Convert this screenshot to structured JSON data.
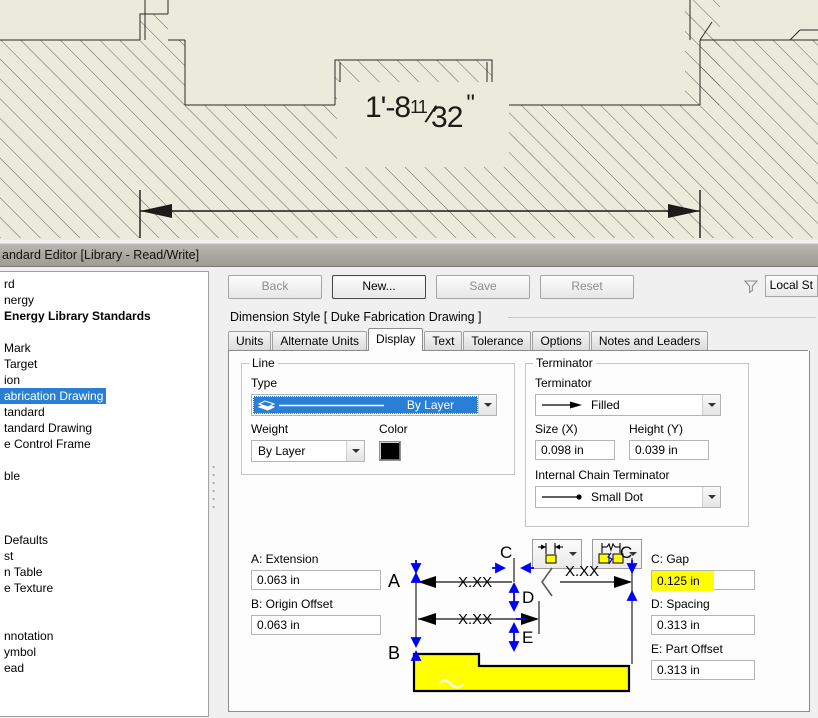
{
  "cad": {
    "dimension_text": {
      "whole": "1'-8",
      "numerator": "11",
      "denominator": "32",
      "unit_mark": "\""
    },
    "background_color": "#eceadb",
    "line_color": "#2b2b24"
  },
  "window": {
    "title": "andard Editor [Library - Read/Write]"
  },
  "tree": {
    "items": [
      {
        "label": "rd",
        "bold": false,
        "selected": false
      },
      {
        "label": "nergy",
        "bold": false,
        "selected": false
      },
      {
        "label": "Energy Library Standards",
        "bold": true,
        "selected": false
      },
      {
        "label": "",
        "bold": false,
        "selected": false
      },
      {
        "label": "Mark",
        "bold": false,
        "selected": false
      },
      {
        "label": "Target",
        "bold": false,
        "selected": false
      },
      {
        "label": "ion",
        "bold": false,
        "selected": false
      },
      {
        "label": "abrication Drawing",
        "bold": false,
        "selected": true
      },
      {
        "label": "tandard",
        "bold": false,
        "selected": false
      },
      {
        "label": "tandard Drawing",
        "bold": false,
        "selected": false
      },
      {
        "label": "e Control Frame",
        "bold": false,
        "selected": false
      },
      {
        "label": "",
        "bold": false,
        "selected": false
      },
      {
        "label": "ble",
        "bold": false,
        "selected": false
      },
      {
        "label": "",
        "bold": false,
        "selected": false
      },
      {
        "label": "",
        "bold": false,
        "selected": false
      },
      {
        "label": "",
        "bold": false,
        "selected": false
      },
      {
        "label": "Defaults",
        "bold": false,
        "selected": false
      },
      {
        "label": "st",
        "bold": false,
        "selected": false
      },
      {
        "label": "n Table",
        "bold": false,
        "selected": false
      },
      {
        "label": "e Texture",
        "bold": false,
        "selected": false
      },
      {
        "label": "",
        "bold": false,
        "selected": false
      },
      {
        "label": "",
        "bold": false,
        "selected": false
      },
      {
        "label": "nnotation",
        "bold": false,
        "selected": false
      },
      {
        "label": "ymbol",
        "bold": false,
        "selected": false
      },
      {
        "label": "ead",
        "bold": false,
        "selected": false
      }
    ],
    "selection_color": "#2a7fd4"
  },
  "toolbar": {
    "back_label": "Back",
    "new_label": "New...",
    "save_label": "Save",
    "reset_label": "Reset",
    "filter_icon": "filter-funnel-icon",
    "scope_selector_value": "Local St"
  },
  "style_header": {
    "label": "Dimension Style [ Duke Fabrication Drawing ]"
  },
  "tabs": [
    {
      "label": "Units",
      "active": false
    },
    {
      "label": "Alternate Units",
      "active": false
    },
    {
      "label": "Display",
      "active": true
    },
    {
      "label": "Text",
      "active": false
    },
    {
      "label": "Tolerance",
      "active": false
    },
    {
      "label": "Options",
      "active": false
    },
    {
      "label": "Notes and Leaders",
      "active": false
    }
  ],
  "display_tab": {
    "line_group": {
      "legend": "Line",
      "type_label": "Type",
      "type_value": "By Layer",
      "weight_label": "Weight",
      "weight_value": "By Layer",
      "color_label": "Color",
      "color_value": "#000000"
    },
    "terminator_group": {
      "legend": "Terminator",
      "terminator_label": "Terminator",
      "terminator_value": "Filled",
      "size_label": "Size (X)",
      "size_value": "0.098 in",
      "height_label": "Height (Y)",
      "height_value": "0.039 in",
      "internal_chain_label": "Internal Chain Terminator",
      "internal_chain_value": "Small Dot"
    },
    "spacing_buttons": [
      {
        "name": "dimension-arrangement-button",
        "icon": "dimension-inside-icon"
      },
      {
        "name": "dimension-break-button",
        "icon": "dimension-break-icon"
      }
    ],
    "fields": {
      "a_label": "A: Extension",
      "a_value": "0.063 in",
      "b_label": "B: Origin Offset",
      "b_value": "0.063 in",
      "c_label": "C: Gap",
      "c_value": "0.125 in",
      "c_highlight_color": "#ffff00",
      "d_label": "D: Spacing",
      "d_value": "0.313 in",
      "e_label": "E: Part Offset",
      "e_value": "0.313 in"
    },
    "diagram": {
      "markers": [
        "A",
        "B",
        "C",
        "C",
        "D",
        "E"
      ],
      "dimension_placeholders": [
        "X.XX",
        "X.XX",
        "X.XX"
      ],
      "part_fill_color": "#ffff00",
      "annotation_color": "#0000ff"
    }
  }
}
